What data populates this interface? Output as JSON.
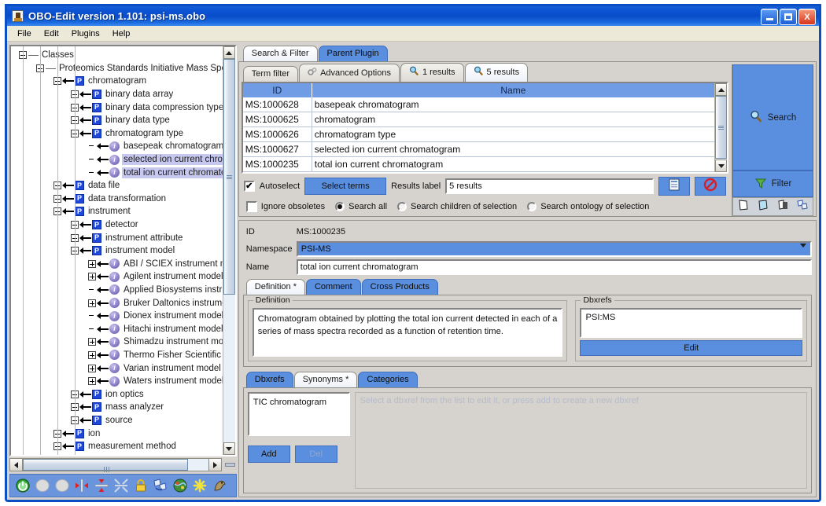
{
  "window": {
    "title": "OBO-Edit version 1.101: psi-ms.obo",
    "app_icon": "obo-edit-icon",
    "minimize": "_",
    "maximize": "□",
    "close": "X"
  },
  "menu": {
    "items": [
      "File",
      "Edit",
      "Plugins",
      "Help"
    ]
  },
  "tree": {
    "nodes": [
      {
        "depth": 0,
        "toggle": "minus",
        "connector": "dash",
        "badge": "none",
        "label": "Classes",
        "selected": false
      },
      {
        "depth": 1,
        "toggle": "minus",
        "connector": "dash",
        "badge": "none",
        "label": "Proteomics Standards Initiative Mass Spectrom",
        "selected": false
      },
      {
        "depth": 2,
        "toggle": "minus",
        "connector": "arrow",
        "badge": "P",
        "label": "chromatogram",
        "selected": false
      },
      {
        "depth": 3,
        "toggle": "plus",
        "connector": "arrow",
        "badge": "P",
        "label": "binary data array",
        "selected": false
      },
      {
        "depth": 3,
        "toggle": "plus",
        "connector": "arrow",
        "badge": "P",
        "label": "binary data compression type",
        "selected": false
      },
      {
        "depth": 3,
        "toggle": "plus",
        "connector": "arrow",
        "badge": "P",
        "label": "binary data type",
        "selected": false
      },
      {
        "depth": 3,
        "toggle": "minus",
        "connector": "arrow",
        "badge": "P",
        "label": "chromatogram type",
        "selected": false
      },
      {
        "depth": 4,
        "toggle": "none",
        "connector": "arrow",
        "badge": "i",
        "label": "basepeak chromatogram",
        "selected": false
      },
      {
        "depth": 4,
        "toggle": "none",
        "connector": "arrow",
        "badge": "i",
        "label": "selected ion current chroma",
        "selected": true
      },
      {
        "depth": 4,
        "toggle": "none",
        "connector": "arrow",
        "badge": "i",
        "label": "total ion current chromatog",
        "selected": true
      },
      {
        "depth": 2,
        "toggle": "plus",
        "connector": "arrow",
        "badge": "P",
        "label": "data file",
        "selected": false
      },
      {
        "depth": 2,
        "toggle": "plus",
        "connector": "arrow",
        "badge": "P",
        "label": "data transformation",
        "selected": false
      },
      {
        "depth": 2,
        "toggle": "minus",
        "connector": "arrow",
        "badge": "P",
        "label": "instrument",
        "selected": false
      },
      {
        "depth": 3,
        "toggle": "plus",
        "connector": "arrow",
        "badge": "P",
        "label": "detector",
        "selected": false
      },
      {
        "depth": 3,
        "toggle": "plus",
        "connector": "arrow",
        "badge": "P",
        "label": "instrument attribute",
        "selected": false
      },
      {
        "depth": 3,
        "toggle": "minus",
        "connector": "arrow",
        "badge": "P",
        "label": "instrument model",
        "selected": false
      },
      {
        "depth": 4,
        "toggle": "plus",
        "connector": "arrow",
        "badge": "i",
        "label": "ABI / SCIEX instrument mod",
        "selected": false
      },
      {
        "depth": 4,
        "toggle": "plus",
        "connector": "arrow",
        "badge": "i",
        "label": "Agilent instrument model",
        "selected": false
      },
      {
        "depth": 4,
        "toggle": "none",
        "connector": "arrow",
        "badge": "i",
        "label": "Applied Biosystems instrume",
        "selected": false
      },
      {
        "depth": 4,
        "toggle": "plus",
        "connector": "arrow",
        "badge": "i",
        "label": "Bruker Daltonics instrument",
        "selected": false
      },
      {
        "depth": 4,
        "toggle": "none",
        "connector": "arrow",
        "badge": "i",
        "label": "Dionex instrument model",
        "selected": false
      },
      {
        "depth": 4,
        "toggle": "none",
        "connector": "arrow",
        "badge": "i",
        "label": "Hitachi instrument model",
        "selected": false
      },
      {
        "depth": 4,
        "toggle": "plus",
        "connector": "arrow",
        "badge": "i",
        "label": "Shimadzu instrument mode",
        "selected": false
      },
      {
        "depth": 4,
        "toggle": "plus",
        "connector": "arrow",
        "badge": "i",
        "label": "Thermo Fisher Scientific ins",
        "selected": false
      },
      {
        "depth": 4,
        "toggle": "plus",
        "connector": "arrow",
        "badge": "i",
        "label": "Varian instrument model",
        "selected": false
      },
      {
        "depth": 4,
        "toggle": "plus",
        "connector": "arrow",
        "badge": "i",
        "label": "Waters instrument model",
        "selected": false
      },
      {
        "depth": 3,
        "toggle": "plus",
        "connector": "arrow",
        "badge": "P",
        "label": "ion optics",
        "selected": false
      },
      {
        "depth": 3,
        "toggle": "plus",
        "connector": "arrow",
        "badge": "P",
        "label": "mass analyzer",
        "selected": false
      },
      {
        "depth": 3,
        "toggle": "plus",
        "connector": "arrow",
        "badge": "P",
        "label": "source",
        "selected": false
      },
      {
        "depth": 2,
        "toggle": "plus",
        "connector": "arrow",
        "badge": "P",
        "label": "ion",
        "selected": false
      },
      {
        "depth": 2,
        "toggle": "plus",
        "connector": "arrow",
        "badge": "P",
        "label": "measurement method",
        "selected": false
      }
    ]
  },
  "bottom_toolbar": {
    "buttons": [
      {
        "name": "power-icon",
        "glyph": "⏻"
      },
      {
        "name": "blank-circle-icon-1",
        "glyph": ""
      },
      {
        "name": "blank-circle-icon-2",
        "glyph": ""
      },
      {
        "name": "horizontal-split-icon",
        "glyph": ""
      },
      {
        "name": "vertical-split-icon",
        "glyph": ""
      },
      {
        "name": "collapse-icon",
        "glyph": ""
      },
      {
        "name": "lock-icon",
        "glyph": ""
      },
      {
        "name": "refresh-icon",
        "glyph": ""
      },
      {
        "name": "globe-icon",
        "glyph": ""
      },
      {
        "name": "star-icon",
        "glyph": "✳"
      },
      {
        "name": "monkey-icon",
        "glyph": ""
      }
    ]
  },
  "search_panel": {
    "plugin_tabs": [
      {
        "label": "Search & Filter",
        "active": true
      },
      {
        "label": "Parent Plugin",
        "active": false
      }
    ],
    "sub_tabs": [
      {
        "label": "Term filter",
        "icon": "",
        "active": false
      },
      {
        "label": "Advanced Options",
        "icon": "gears-icon",
        "active": false
      },
      {
        "label": "1 results",
        "icon": "magnifier-icon",
        "active": false
      },
      {
        "label": "5 results",
        "icon": "magnifier-icon",
        "active": true
      }
    ],
    "table": {
      "columns": [
        "ID",
        "Name"
      ],
      "rows": [
        {
          "id": "MS:1000628",
          "name": "basepeak chromatogram"
        },
        {
          "id": "MS:1000625",
          "name": "chromatogram"
        },
        {
          "id": "MS:1000626",
          "name": "chromatogram type"
        },
        {
          "id": "MS:1000627",
          "name": "selected ion current chromatogram"
        },
        {
          "id": "MS:1000235",
          "name": "total ion current chromatogram"
        }
      ]
    },
    "controls": {
      "autoselect_label": "Autoselect",
      "autoselect_checked": true,
      "autoselect_mark": "✔",
      "select_terms_label": "Select terms",
      "results_label_caption": "Results label",
      "results_label_value": "5 results",
      "save_icon": "document-save-icon",
      "clear_icon": "no-entry-icon"
    },
    "options": {
      "ignore_obsoletes_label": "Ignore obsoletes",
      "ignore_obsoletes_checked": false,
      "radios": [
        {
          "label": "Search all",
          "selected": true
        },
        {
          "label": "Search children of selection",
          "selected": false
        },
        {
          "label": "Search ontology of selection",
          "selected": false
        }
      ]
    },
    "side": {
      "search_label": "Search",
      "search_icon": "magnifier-icon",
      "filter_label": "Filter",
      "filter_icon": "funnel-icon",
      "small_buttons": [
        {
          "name": "new-page-icon"
        },
        {
          "name": "new-folder-icon"
        },
        {
          "name": "save-page-icon"
        },
        {
          "name": "swap-icon"
        }
      ]
    }
  },
  "term_editor": {
    "id_label": "ID",
    "id_value": "MS:1000235",
    "namespace_label": "Namespace",
    "namespace_value": "PSI-MS",
    "name_label": "Name",
    "name_value": "total ion current chromatogram",
    "tabs": [
      {
        "label": "Definition *",
        "active": true
      },
      {
        "label": "Comment",
        "active": false
      },
      {
        "label": "Cross Products",
        "active": false
      }
    ],
    "definition_group_title": "Definition",
    "definition_text": "Chromatogram obtained by plotting the total ion current detected in each of a series of mass spectra recorded as a function of retention time.",
    "dbxrefs_group_title": "Dbxrefs",
    "dbxrefs_value": "PSI:MS",
    "dbxrefs_edit_label": "Edit",
    "lower_tabs": [
      {
        "label": "Dbxrefs",
        "active": false
      },
      {
        "label": "Synonyms *",
        "active": true
      },
      {
        "label": "Categories",
        "active": false
      }
    ],
    "synonyms_list": [
      "TIC chromatogram"
    ],
    "add_label": "Add",
    "del_label": "Del",
    "hint_text": "Select a dbxref from the list to edit it, or press add to create a new dbxref"
  },
  "colors": {
    "title_bar_blue": "#0c55d4",
    "accent_blue": "#5a8ede",
    "header_blue": "#6f9ce4",
    "panel_grey": "#d6d3ce",
    "selection_lavender": "#c7c8ef",
    "toolbar_blue": "#6a95dd"
  }
}
